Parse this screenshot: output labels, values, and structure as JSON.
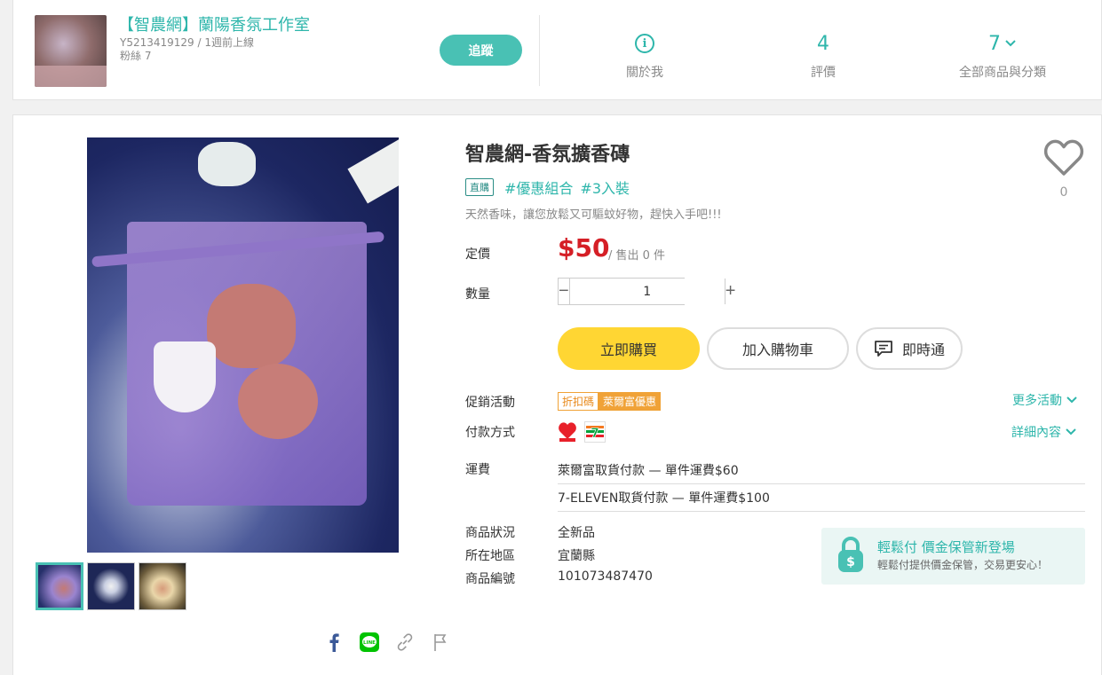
{
  "seller": {
    "name": "【智農網】蘭陽香氛工作室",
    "id_line": "Y5213419129 / 1週前上線",
    "followers": "粉絲 7",
    "follow_label": "追蹤",
    "stats": [
      {
        "value": "",
        "icon": "info-icon",
        "label": "關於我"
      },
      {
        "value": "4",
        "label": "評價"
      },
      {
        "value": "7",
        "icon": "chevron-down-icon",
        "label": "全部商品與分類"
      }
    ]
  },
  "product": {
    "title": "智農網-香氛擴香磚",
    "direct_badge": "直購",
    "hashtags": [
      "#優惠組合",
      "#3入裝"
    ],
    "tagline": "天然香味，讓您放鬆又可驅蚊好物，趕快入手吧!!!",
    "favorite_count": "0",
    "price_label": "定價",
    "price": "$50",
    "sold": "/ 售出 0 件",
    "quantity_label": "數量",
    "quantity": "1",
    "buy_now": "立即購買",
    "add_to_cart": "加入購物車",
    "chat": "即時通",
    "promo_label": "促銷活動",
    "promo_badges": [
      "折扣碼",
      "萊爾富優惠"
    ],
    "more_promos": "更多活動",
    "payment_label": "付款方式",
    "payment_details": "詳細內容",
    "shipping_label": "運費",
    "shipping": [
      "萊爾富取貨付款 — 單件運費$60",
      "7-ELEVEN取貨付款 — 單件運費$100"
    ],
    "details": [
      {
        "label": "商品狀況",
        "value": "全新品"
      },
      {
        "label": "所在地區",
        "value": "宜蘭縣"
      },
      {
        "label": "商品編號",
        "value": "101073487470"
      }
    ],
    "safe_pay": {
      "title": "輕鬆付 價金保管新登場",
      "subtitle": "輕鬆付提供價金保管，交易更安心！"
    },
    "pay_icon_labels": [
      "Hi-Life",
      "7-ELEVEN"
    ]
  },
  "colors": {
    "accent": "#2eb6ab",
    "price": "#d51f26",
    "buy_button": "#ffd633",
    "promo": "#f0a237"
  }
}
